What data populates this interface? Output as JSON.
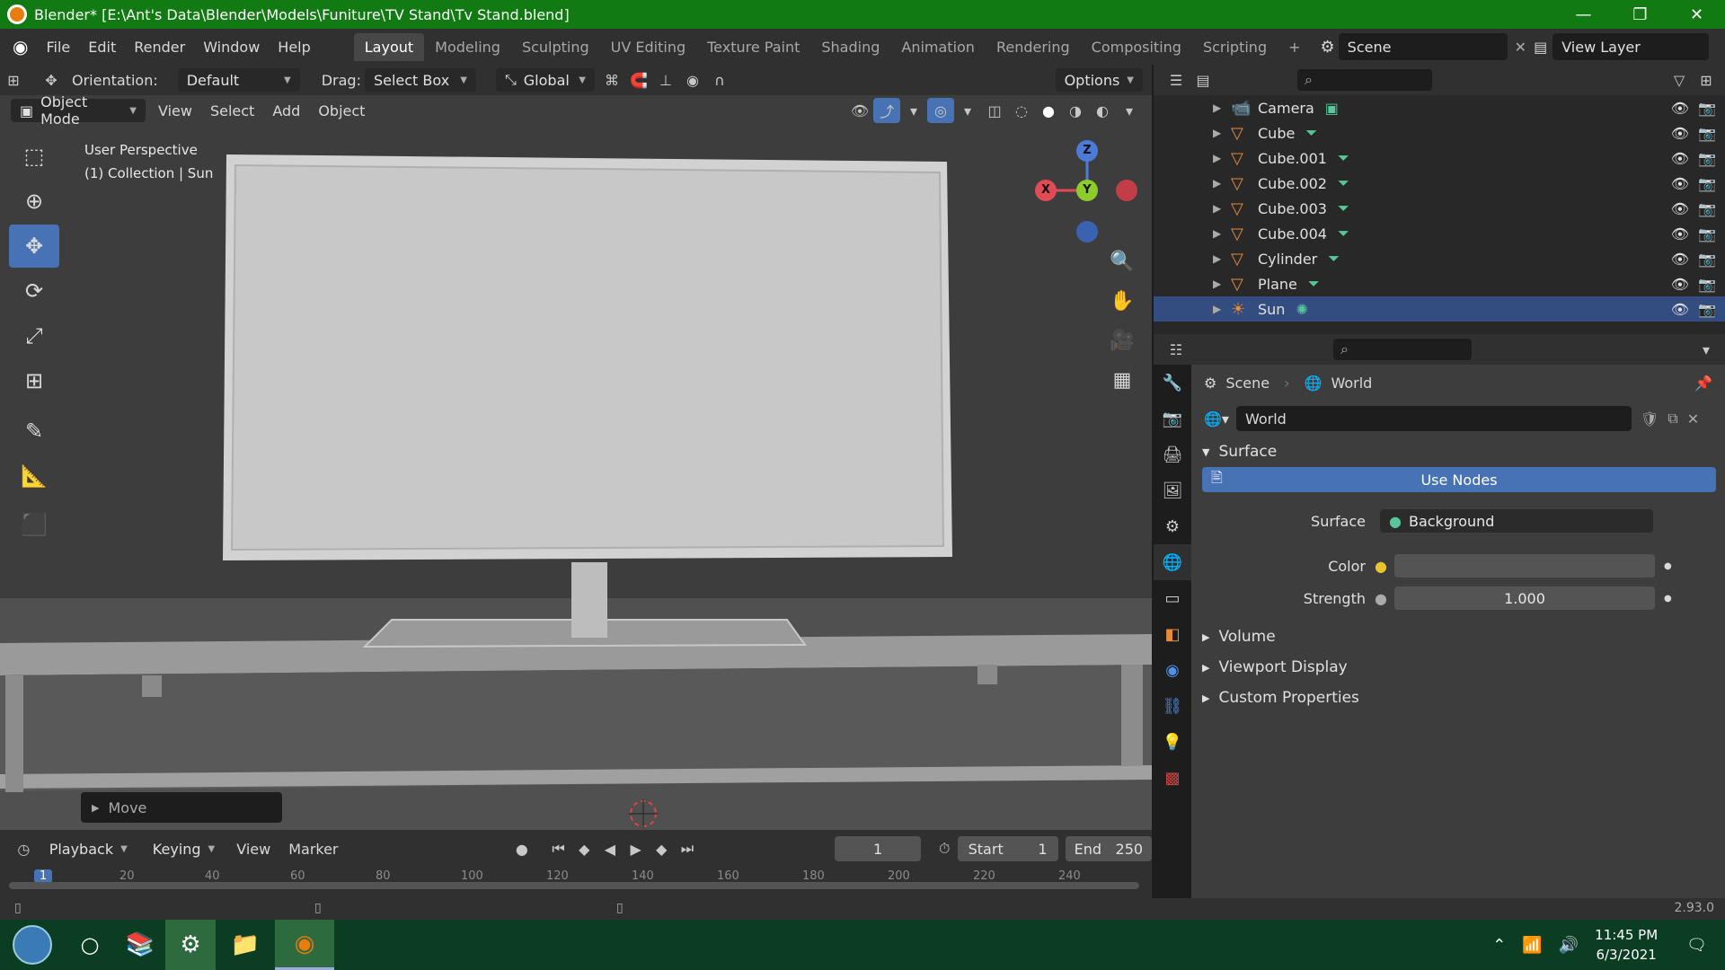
{
  "window": {
    "title": "Blender* [E:\\Ant's Data\\Blender\\Models\\Funiture\\TV Stand\\Tv Stand.blend]",
    "controls": [
      "—",
      "❐",
      "✕"
    ]
  },
  "menubar": {
    "items": [
      "File",
      "Edit",
      "Render",
      "Window",
      "Help"
    ],
    "workspaces": [
      "Layout",
      "Modeling",
      "Sculpting",
      "UV Editing",
      "Texture Paint",
      "Shading",
      "Animation",
      "Rendering",
      "Compositing",
      "Scripting"
    ],
    "active_workspace": "Layout",
    "add_tab": "+",
    "scene": "Scene",
    "view_layer": "View Layer"
  },
  "tool_header": {
    "orientation_label": "Orientation:",
    "orientation_value": "Default",
    "drag_label": "Drag:",
    "drag_value": "Select Box",
    "transform_space": "Global",
    "options_label": "Options"
  },
  "viewport_header": {
    "mode": "Object Mode",
    "menus": [
      "View",
      "Select",
      "Add",
      "Object"
    ]
  },
  "viewport": {
    "view_name": "User Perspective",
    "collection_info": "(1) Collection | Sun",
    "gizmo_axes": [
      "Z",
      "Y",
      "X"
    ],
    "last_op": "Move",
    "tools": [
      {
        "name": "select-box-tool",
        "glyph": "⬚"
      },
      {
        "name": "cursor-tool",
        "glyph": "⊕"
      },
      {
        "name": "move-tool",
        "glyph": "✥"
      },
      {
        "name": "rotate-tool",
        "glyph": "⟳"
      },
      {
        "name": "scale-tool",
        "glyph": "⤢"
      },
      {
        "name": "transform-tool",
        "glyph": "⊞"
      },
      {
        "name": "annotate-tool",
        "glyph": "✎"
      },
      {
        "name": "measure-tool",
        "glyph": "📐"
      },
      {
        "name": "add-cube-tool",
        "glyph": "⬛"
      }
    ],
    "active_tool": "move-tool"
  },
  "timeline": {
    "menus": [
      "Playback",
      "Keying",
      "View",
      "Marker"
    ],
    "current_frame": "1",
    "start_label": "Start",
    "start_value": "1",
    "end_label": "End",
    "end_value": "250",
    "ruler_ticks": [
      "1",
      "20",
      "40",
      "60",
      "80",
      "100",
      "120",
      "140",
      "160",
      "180",
      "200",
      "220",
      "240"
    ]
  },
  "outliner": {
    "items": [
      {
        "label": "Camera",
        "icon": "camera-icon",
        "selected": false
      },
      {
        "label": "Cube",
        "icon": "mesh-icon",
        "selected": false
      },
      {
        "label": "Cube.001",
        "icon": "mesh-icon",
        "selected": false
      },
      {
        "label": "Cube.002",
        "icon": "mesh-icon",
        "selected": false
      },
      {
        "label": "Cube.003",
        "icon": "mesh-icon",
        "selected": false
      },
      {
        "label": "Cube.004",
        "icon": "mesh-icon",
        "selected": false
      },
      {
        "label": "Cylinder",
        "icon": "mesh-icon",
        "selected": false
      },
      {
        "label": "Plane",
        "icon": "mesh-icon",
        "selected": false
      },
      {
        "label": "Sun",
        "icon": "light-icon",
        "selected": true
      }
    ]
  },
  "properties": {
    "breadcrumb": [
      "Scene",
      "World"
    ],
    "world_name": "World",
    "surface_panel": "Surface",
    "use_nodes": "Use Nodes",
    "surface_label": "Surface",
    "surface_value": "Background",
    "color_label": "Color",
    "strength_label": "Strength",
    "strength_value": "1.000",
    "collapsed_panels": [
      "Volume",
      "Viewport Display",
      "Custom Properties"
    ]
  },
  "statusbar": {
    "version": "2.93.0"
  },
  "taskbar": {
    "time": "11:45 PM",
    "date": "6/3/2021"
  },
  "colors": {
    "title_green": "#117a12",
    "selection_blue": "#4772b3",
    "outliner_selected": "#334d80",
    "mesh_orange": "#e88a3c"
  }
}
